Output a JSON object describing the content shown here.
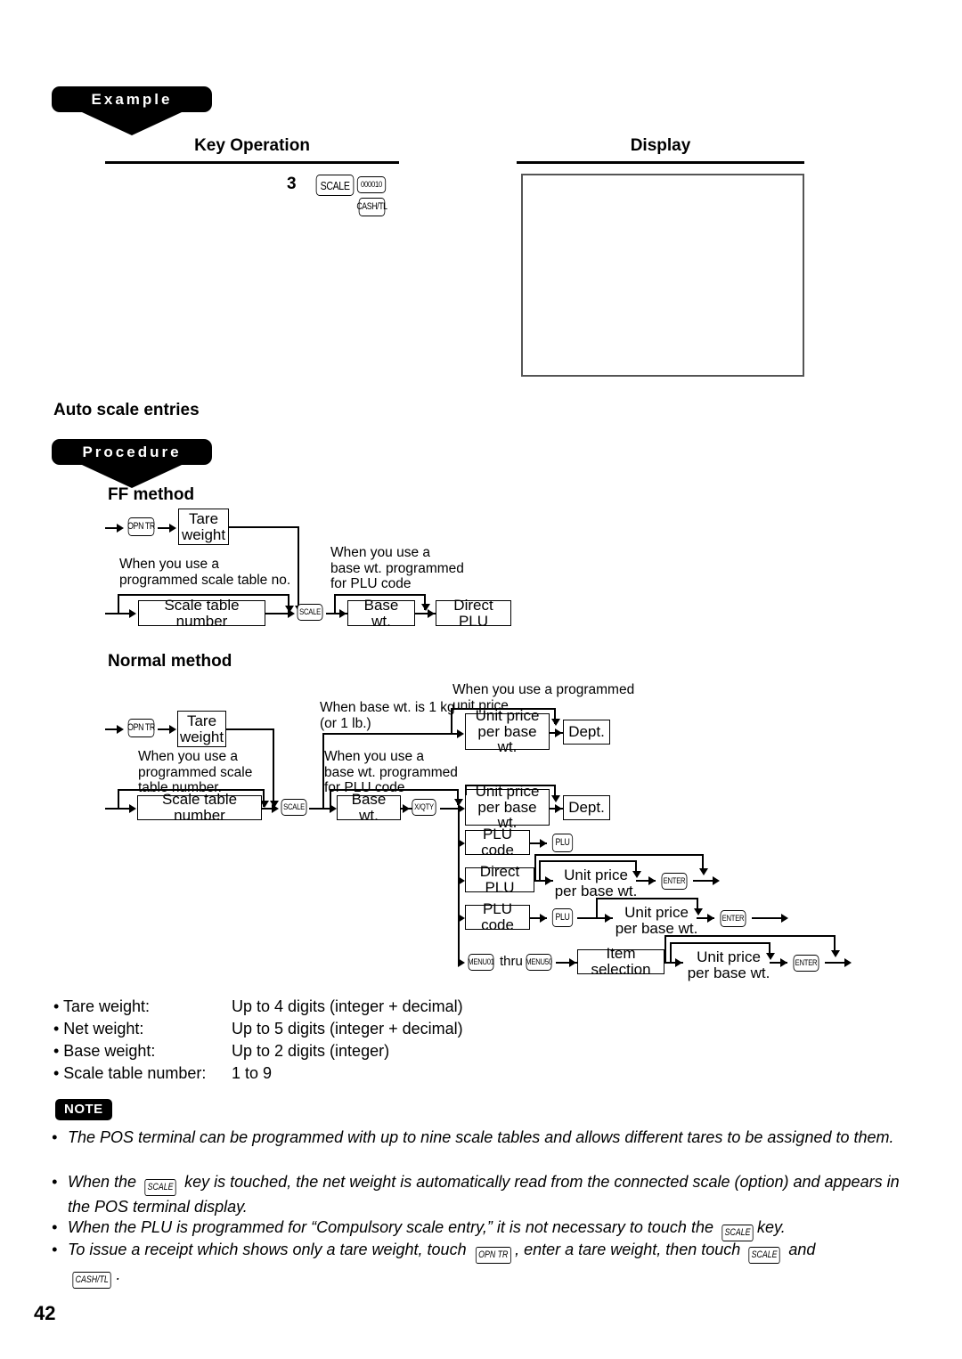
{
  "page": {
    "number": "42"
  },
  "example": {
    "tag": "Example",
    "columns": {
      "key_operation": "Key Operation",
      "display": "Display"
    },
    "key_sequence": {
      "amount": "3",
      "keys": [
        "SCALE",
        "000010",
        "CASH/TL"
      ]
    },
    "display_content": ""
  },
  "auto_scale": {
    "heading": "Auto scale entries",
    "procedure_tag": "Procedure",
    "ff_method": {
      "title": "FF method",
      "captions": [
        "When you use a\nprogrammed scale table no.",
        "When you use a\nbase wt. programmed\nfor PLU code"
      ],
      "nodes": [
        {
          "type": "key",
          "label": "OPN TR"
        },
        {
          "type": "box",
          "label": "Tare\nweight"
        },
        {
          "type": "box",
          "label": "Scale table number"
        },
        {
          "type": "key",
          "label": "SCALE"
        },
        {
          "type": "box",
          "label": "Base wt."
        },
        {
          "type": "box",
          "label": "Direct PLU"
        }
      ]
    },
    "normal_method": {
      "title": "Normal method",
      "captions": [
        "When you use a\nprogrammed scale\ntable number.",
        "When base wt. is 1 kg\n(or 1 lb.)",
        "When you use a\nbase wt. programmed\nfor PLU code",
        "When you use a programmed\nunit price"
      ],
      "nodes": [
        {
          "type": "key",
          "label": "OPN TR"
        },
        {
          "type": "box",
          "label": "Tare\nweight"
        },
        {
          "type": "box",
          "label": "Scale table number"
        },
        {
          "type": "key",
          "label": "SCALE"
        },
        {
          "type": "box",
          "label": "Base wt."
        },
        {
          "type": "key",
          "label": "X/QTY"
        },
        {
          "type": "box",
          "label": "Unit price\nper base wt."
        },
        {
          "type": "box",
          "label": "Dept."
        },
        {
          "type": "box",
          "label": "PLU code"
        },
        {
          "type": "key",
          "label": "PLU"
        },
        {
          "type": "box",
          "label": "Direct PLU"
        },
        {
          "type": "key",
          "label": "ENTER"
        },
        {
          "type": "key",
          "label": "MENU01"
        },
        {
          "type": "text",
          "label": "thru"
        },
        {
          "type": "key",
          "label": "MENU50"
        },
        {
          "type": "box",
          "label": "Item selection"
        }
      ],
      "labels": {
        "unit_price": "Unit price\nper base wt.",
        "dept": "Dept.",
        "plu_code": "PLU code",
        "direct_plu": "Direct PLU",
        "item_selection": "Item selection",
        "thru": "thru"
      }
    }
  },
  "specs": [
    {
      "label": "• Tare weight:",
      "value": "Up to 4 digits (integer + decimal)"
    },
    {
      "label": "• Net weight:",
      "value": "Up to 5 digits (integer + decimal)"
    },
    {
      "label": "• Base weight:",
      "value": "Up to 2 digits (integer)"
    },
    {
      "label": "• Scale table number:",
      "value": "1 to 9"
    }
  ],
  "note": {
    "tag": "NOTE",
    "items": [
      {
        "parts": [
          {
            "t": "text",
            "v": "The POS terminal can be programmed with up to nine scale tables and allows different tares to be assigned to them."
          }
        ]
      },
      {
        "parts": [
          {
            "t": "text",
            "v": "When the "
          },
          {
            "t": "key",
            "v": "SCALE"
          },
          {
            "t": "text",
            "v": " key is touched, the net weight is automatically read from the connected scale (option) and appears in the POS terminal display."
          }
        ]
      },
      {
        "parts": [
          {
            "t": "text",
            "v": "When the PLU is programmed for “Compulsory scale entry,” it is not necessary to touch the "
          },
          {
            "t": "key",
            "v": "SCALE"
          },
          {
            "t": "text",
            "v": "key."
          }
        ]
      },
      {
        "parts": [
          {
            "t": "text",
            "v": "To issue a receipt which shows only a tare weight, touch "
          },
          {
            "t": "key",
            "v": "OPN TR"
          },
          {
            "t": "text",
            "v": ", enter a tare weight, then touch "
          },
          {
            "t": "key",
            "v": "SCALE"
          },
          {
            "t": "text",
            "v": " and "
          },
          {
            "t": "key",
            "v": "CASH/TL"
          },
          {
            "t": "text",
            "v": "."
          }
        ]
      }
    ]
  },
  "colors": {
    "ink": "#000000",
    "display_border": "#555555"
  }
}
